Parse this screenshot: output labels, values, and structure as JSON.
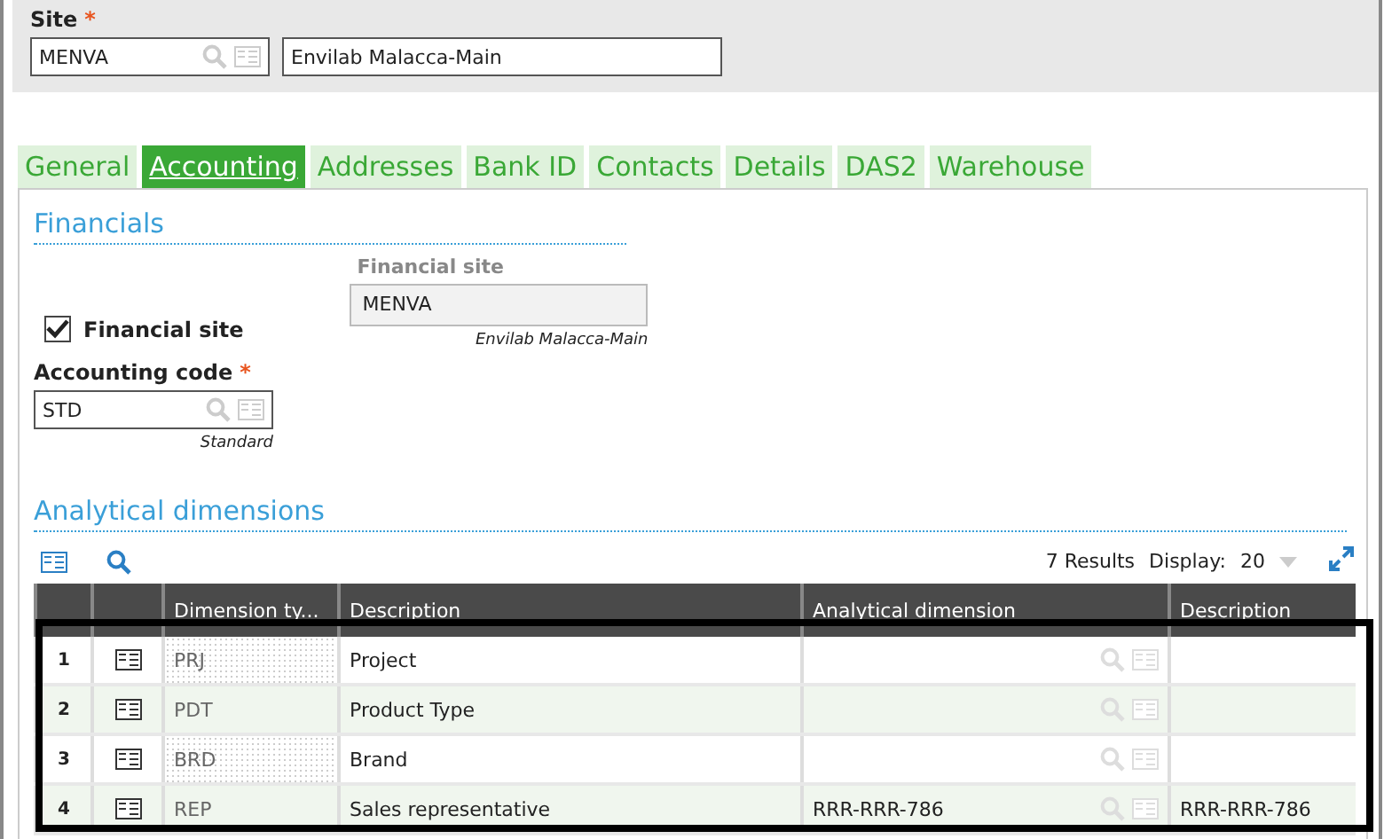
{
  "site": {
    "label": "Site",
    "required_mark": "*",
    "code": "MENVA",
    "name": "Envilab Malacca-Main"
  },
  "tabs": [
    {
      "label": "General",
      "selected": false
    },
    {
      "label": "Accounting",
      "selected": true
    },
    {
      "label": "Addresses",
      "selected": false
    },
    {
      "label": "Bank ID",
      "selected": false
    },
    {
      "label": "Contacts",
      "selected": false
    },
    {
      "label": "Details",
      "selected": false
    },
    {
      "label": "DAS2",
      "selected": false
    },
    {
      "label": "Warehouse",
      "selected": false
    }
  ],
  "financials": {
    "title": "Financials",
    "financial_site_check": {
      "label": "Financial site",
      "checked": true
    },
    "financial_site": {
      "label": "Financial site",
      "value": "MENVA",
      "caption": "Envilab Malacca-Main"
    },
    "accounting_code": {
      "label": "Accounting code",
      "required_mark": "*",
      "value": "STD",
      "caption": "Standard"
    }
  },
  "analytical": {
    "title": "Analytical dimensions",
    "results": "7 Results",
    "display_label": "Display:",
    "display_value": "20",
    "columns": [
      "Dimension ty...",
      "Description",
      "Analytical dimension",
      "Description"
    ],
    "rows": [
      {
        "index": "1",
        "type": "PRJ",
        "description": "Project"
      },
      {
        "index": "2",
        "type": "PDT",
        "description": "Product Type"
      },
      {
        "index": "3",
        "type": "BRD",
        "description": "Brand"
      },
      {
        "index": "4",
        "type": "REP",
        "description": "Sales representative",
        "dimension": "RRR-RRR-786",
        "dimension_description": "RRR-RRR-786"
      }
    ]
  }
}
